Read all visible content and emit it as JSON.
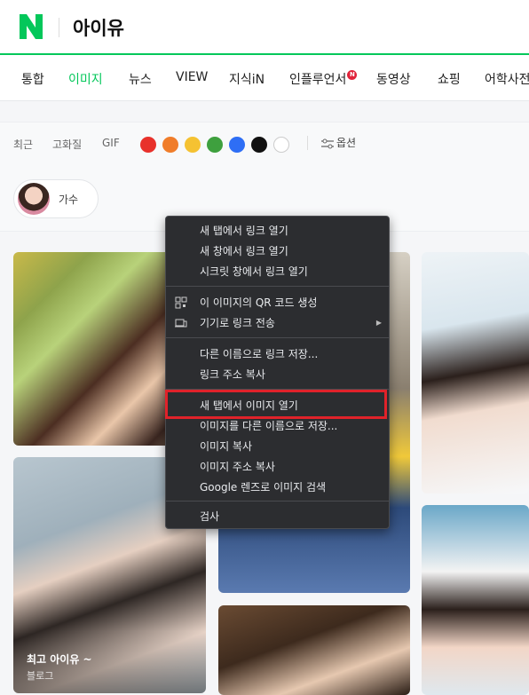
{
  "header": {
    "logo": "N",
    "query": "아이유",
    "accent": "#03c75a"
  },
  "tabs": [
    {
      "label": "통합"
    },
    {
      "label": "이미지",
      "active": true
    },
    {
      "label": "뉴스"
    },
    {
      "label": "VIEW"
    },
    {
      "label": "지식iN"
    },
    {
      "label": "인플루언서",
      "badge": "N"
    },
    {
      "label": "동영상"
    },
    {
      "label": "쇼핑"
    },
    {
      "label": "어학사전"
    }
  ],
  "filters": {
    "items": [
      "최근",
      "고화질",
      "GIF"
    ],
    "colors": [
      "#e8312b",
      "#f07d2a",
      "#f5c232",
      "#3ea03e",
      "#2e6ef5",
      "#111111",
      "#ffffff"
    ],
    "options_label": "옵션"
  },
  "chip": {
    "label": "가수"
  },
  "results": [
    {
      "caption": "",
      "source": ""
    },
    {
      "caption": "최고 아이유 ~",
      "source": "블로그"
    }
  ],
  "context_menu": {
    "groups": [
      [
        "새 탭에서 링크 열기",
        "새 창에서 링크 열기",
        "시크릿 창에서 링크 열기"
      ],
      [
        "이 이미지의 QR 코드 생성",
        "기기로 링크 전송"
      ],
      [
        "다른 이름으로 링크 저장...",
        "링크 주소 복사"
      ],
      [
        "새 탭에서 이미지 열기",
        "이미지를 다른 이름으로 저장...",
        "이미지 복사",
        "이미지 주소 복사",
        "Google 렌즈로 이미지 검색"
      ],
      [
        "검사"
      ]
    ],
    "highlighted": "새 탭에서 이미지 열기",
    "highlight_color": "#e0222a"
  }
}
